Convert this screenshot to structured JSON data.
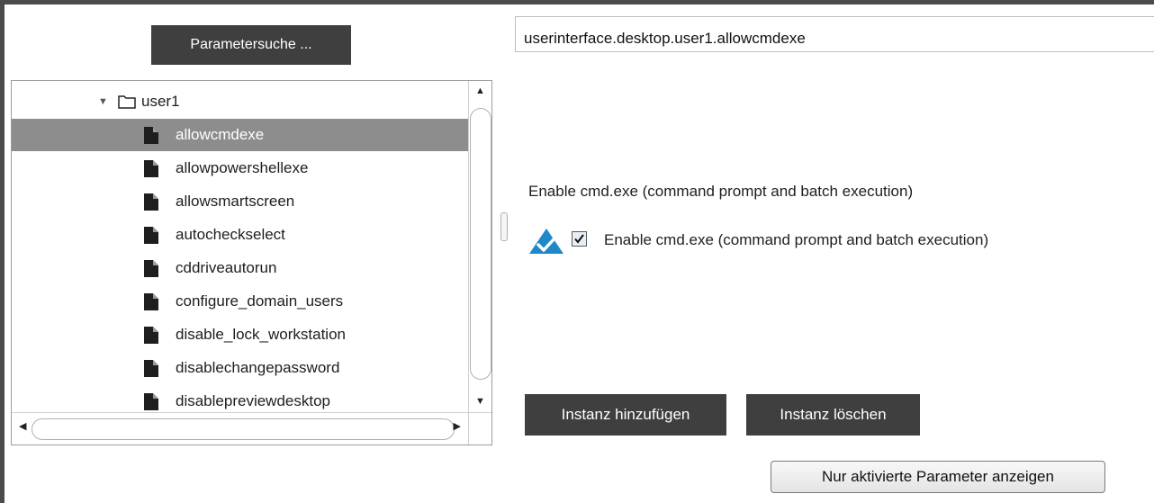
{
  "toolbar": {
    "search_label": "Parametersuche ..."
  },
  "path": {
    "value": "userinterface.desktop.user1.allowcmdexe"
  },
  "tree": {
    "folder": {
      "label": "user1",
      "icon": "folder-icon",
      "expanded": true
    },
    "items": [
      {
        "label": "allowcmdexe",
        "icon": "file-icon",
        "selected": true
      },
      {
        "label": "allowpowershellexe",
        "icon": "file-icon"
      },
      {
        "label": "allowsmartscreen",
        "icon": "file-icon"
      },
      {
        "label": "autocheckselect",
        "icon": "file-icon"
      },
      {
        "label": "cddriveautorun",
        "icon": "file-icon"
      },
      {
        "label": "configure_domain_users",
        "icon": "file-icon"
      },
      {
        "label": "disable_lock_workstation",
        "icon": "file-icon"
      },
      {
        "label": "disablechangepassword",
        "icon": "file-icon"
      },
      {
        "label": "disablepreviewdesktop",
        "icon": "file-icon"
      }
    ]
  },
  "detail": {
    "description": "Enable cmd.exe (command prompt and batch execution)",
    "checkbox_label": "Enable cmd.exe (command prompt and batch execution)",
    "checkbox_checked": true,
    "status_icon": "blue-check-triangle-icon"
  },
  "buttons": {
    "add_instance": "Instanz hinzufügen",
    "delete_instance": "Instanz löschen",
    "show_active_only": "Nur aktivierte Parameter anzeigen"
  },
  "colors": {
    "dark_button": "#3f3f3f",
    "selection": "#8d8d8d",
    "accent_blue": "#1e88c8"
  }
}
